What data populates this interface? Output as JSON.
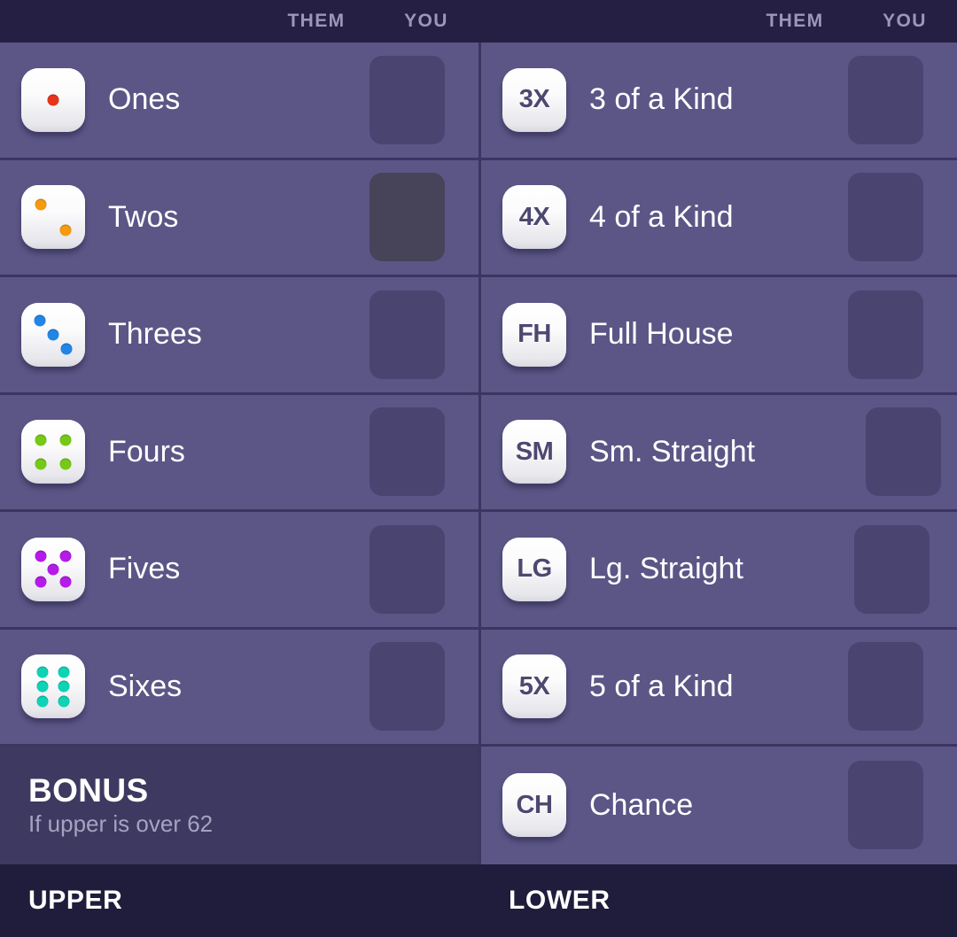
{
  "header": {
    "upper_them": "THEM",
    "upper_you": "YOU",
    "lower_them": "THEM",
    "lower_you": "YOU"
  },
  "colors": {
    "background": "#5b5686",
    "header_bg": "#252043",
    "footer_bg": "#201c3c",
    "divider": "#3b3560",
    "score_box": "#4a4470",
    "score_box_neutral": "#474358",
    "bonus_bg": "#3e3960",
    "label_text": "#ffffff",
    "muted_text": "#a7a2c2",
    "tile_text": "#4d4870",
    "pip_ones": "#e8341a",
    "pip_twos": "#f59a11",
    "pip_threes": "#2186e8",
    "pip_fours": "#76c916",
    "pip_fives": "#b51ae8",
    "pip_sixes": "#0ed3b5"
  },
  "upper": {
    "rows": [
      {
        "id": "ones",
        "label": "Ones",
        "icon": "die-one-icon",
        "pips": 1,
        "pip_color": "#e8341a",
        "them": "",
        "you": ""
      },
      {
        "id": "twos",
        "label": "Twos",
        "icon": "die-two-icon",
        "pips": 2,
        "pip_color": "#f59a11",
        "them": "",
        "you": ""
      },
      {
        "id": "threes",
        "label": "Threes",
        "icon": "die-three-icon",
        "pips": 3,
        "pip_color": "#2186e8",
        "them": "",
        "you": ""
      },
      {
        "id": "fours",
        "label": "Fours",
        "icon": "die-four-icon",
        "pips": 4,
        "pip_color": "#76c916",
        "them": "",
        "you": ""
      },
      {
        "id": "fives",
        "label": "Fives",
        "icon": "die-five-icon",
        "pips": 5,
        "pip_color": "#b51ae8",
        "them": "",
        "you": ""
      },
      {
        "id": "sixes",
        "label": "Sixes",
        "icon": "die-six-icon",
        "pips": 6,
        "pip_color": "#0ed3b5",
        "them": "",
        "you": ""
      }
    ],
    "bonus": {
      "title": "BONUS",
      "subtitle": "If upper is over 62"
    }
  },
  "lower": {
    "rows": [
      {
        "id": "three-of-a-kind",
        "label": "3 of a Kind",
        "chip": "3X",
        "them": "",
        "you": ""
      },
      {
        "id": "four-of-a-kind",
        "label": "4 of a Kind",
        "chip": "4X",
        "them": "",
        "you": ""
      },
      {
        "id": "full-house",
        "label": "Full House",
        "chip": "FH",
        "them": "",
        "you": ""
      },
      {
        "id": "small-straight",
        "label": "Sm. Straight",
        "chip": "SM",
        "them": "",
        "you": ""
      },
      {
        "id": "large-straight",
        "label": "Lg. Straight",
        "chip": "LG",
        "them": "",
        "you": ""
      },
      {
        "id": "five-of-a-kind",
        "label": "5 of a Kind",
        "chip": "5X",
        "them": "",
        "you": ""
      },
      {
        "id": "chance",
        "label": "Chance",
        "chip": "CH",
        "them": "",
        "you": ""
      }
    ]
  },
  "footer": {
    "upper_label": "UPPER",
    "lower_label": "LOWER"
  }
}
